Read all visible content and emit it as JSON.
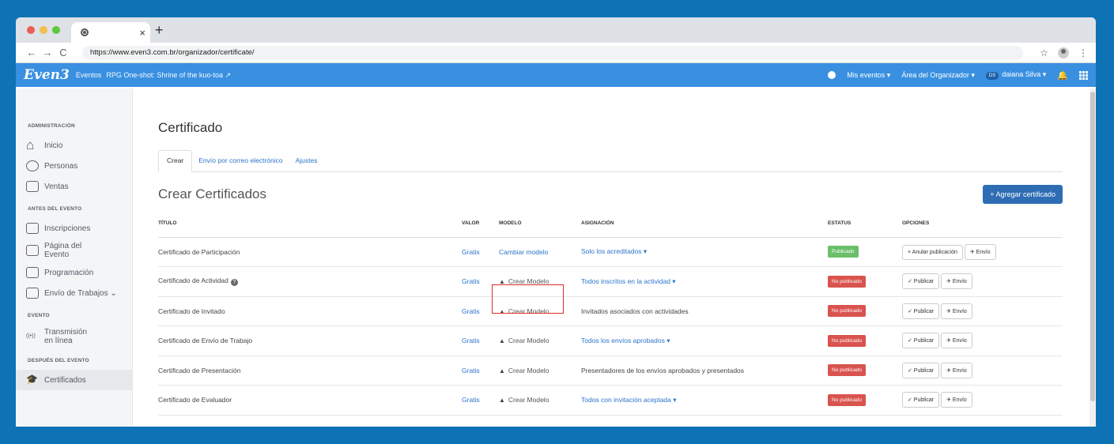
{
  "browser": {
    "tab_close": "×",
    "new_tab": "+",
    "back": "←",
    "forward": "→",
    "reload": "C",
    "url": "https://www.even3.com.br/organizador/certificate/",
    "star": "☆",
    "menu": "⋮"
  },
  "header": {
    "logo": "Even3",
    "crumb_events": "Eventos",
    "crumb_event": "RPG One-shot: Shrine of the kuo-toa ↗",
    "my_events": "Mis eventos ▾",
    "organizer_area": "Área del Organizador ▾",
    "user_initials": "DS",
    "user_name": "daiana Silva ▾",
    "bell": "🔔"
  },
  "sidebar": {
    "sections": [
      {
        "title": "ADMINISTRACIÓN",
        "items": [
          "Inicio",
          "Personas",
          "Ventas"
        ]
      },
      {
        "title": "ANTES DEL EVENTO",
        "items": [
          "Inscripciones",
          "Página del Evento",
          "Programación",
          "Envío de Trabajos ⌄"
        ]
      },
      {
        "title": "EVENTO",
        "items": [
          "Transmisión en línea"
        ]
      },
      {
        "title": "DESPUÉS DEL EVENTO",
        "items": [
          "Certificados"
        ]
      }
    ]
  },
  "main": {
    "page_title": "Certificado",
    "tabs": [
      "Crear",
      "Envío por correo electrónico",
      "Ajustes"
    ],
    "section_title": "Crear Certificados",
    "add_button": "+ Agregar certificado",
    "columns": [
      "TÍTULO",
      "VALOR",
      "MODELO",
      "ASIGNACIÓN",
      "ESTATUS",
      "OPCIONES"
    ],
    "rows": [
      {
        "title": "Certificado de Participación",
        "valor": "Gratis",
        "modelo": "Cambiar modelo",
        "asignacion": "Solo los acreditados ▾",
        "estatus": "Publicado",
        "opt1": "× Anular publicación",
        "opt2": "✈ Envío"
      },
      {
        "title": "Certificado de Actividad",
        "valor": "Gratis",
        "modelo": "Crear Modelo",
        "asignacion": "Todos inscritos en la actividad ▾",
        "estatus": "No publicado",
        "opt1": "✓ Publicar",
        "opt2": "✈ Envío"
      },
      {
        "title": "Certificado de Invitado",
        "valor": "Gratis",
        "modelo": "Crear Modelo",
        "asignacion": "Invitados asociados con actividades",
        "estatus": "No publicado",
        "opt1": "✓ Publicar",
        "opt2": "✈ Envío"
      },
      {
        "title": "Certificado de Envío de Trabajo",
        "valor": "Gratis",
        "modelo": "Crear Modelo",
        "asignacion": "Todos los envíos aprobados ▾",
        "estatus": "No publicado",
        "opt1": "✓ Publicar",
        "opt2": "✈ Envío"
      },
      {
        "title": "Certificado de Presentación",
        "valor": "Gratis",
        "modelo": "Crear Modelo",
        "asignacion": "Presentadores de los envíos aprobados y presentados",
        "estatus": "No publicado",
        "opt1": "✓ Publicar",
        "opt2": "✈ Envío"
      },
      {
        "title": "Certificado de Evaluador",
        "valor": "Gratis",
        "modelo": "Crear Modelo",
        "asignacion": "Todos con invitación aceptada ▾",
        "estatus": "No publicado",
        "opt1": "✓ Publicar",
        "opt2": "✈ Envío"
      }
    ]
  },
  "colors": {
    "background": "#0d73b5",
    "appbar": "#3a90e0",
    "link": "#2a74c9",
    "published": "#6bbf6a",
    "unpublished": "#d9534f",
    "highlight": "#e02a2a"
  }
}
